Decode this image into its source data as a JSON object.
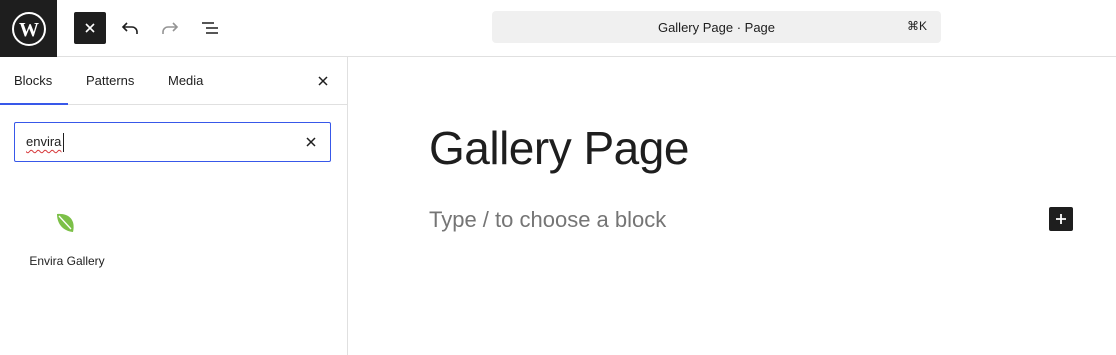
{
  "topbar": {
    "logo_icon": "wordpress-logo-icon",
    "close_icon": "close-icon",
    "undo_icon": "undo-icon",
    "redo_icon": "redo-icon",
    "list_view_icon": "list-view-icon",
    "command_bar": {
      "title": "Gallery Page · Page",
      "shortcut": "⌘K"
    }
  },
  "sidebar": {
    "tabs": [
      {
        "label": "Blocks",
        "active": true
      },
      {
        "label": "Patterns",
        "active": false
      },
      {
        "label": "Media",
        "active": false
      }
    ],
    "close_icon": "close-icon",
    "search": {
      "value": "envira",
      "clear_icon": "close-icon"
    },
    "results": [
      {
        "label": "Envira Gallery",
        "icon": "leaf-icon"
      }
    ]
  },
  "editor": {
    "title": "Gallery Page",
    "placeholder": "Type / to choose a block",
    "add_block_icon": "plus-icon"
  },
  "colors": {
    "accent": "#3858e9",
    "dark": "#1e1e1e",
    "leaf": "#7cc048",
    "placeholder": "#757575"
  }
}
